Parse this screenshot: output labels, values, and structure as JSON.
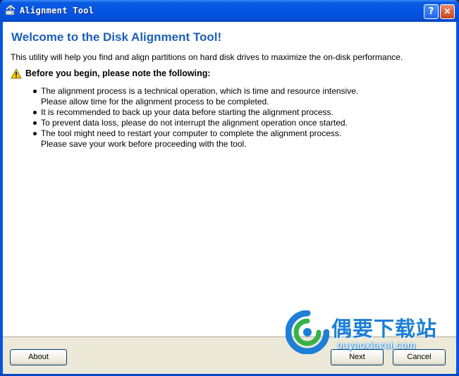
{
  "window": {
    "title": "Alignment Tool",
    "help_label": "?",
    "close_label": "×"
  },
  "content": {
    "welcome": "Welcome to the Disk Alignment Tool!",
    "intro": "This utility will help you find and align partitions on hard disk drives to maximize the on-disk performance.",
    "note_heading": "Before you begin, please note the following:",
    "bullets": [
      {
        "line1": "The alignment process is a technical operation, which is time and resource intensive.",
        "line2": "Please allow time for the alignment process to be completed."
      },
      {
        "line1": "It is recommended to back up your data before starting the alignment process.",
        "line2": ""
      },
      {
        "line1": "To prevent data loss, please do not interrupt the alignment operation once started.",
        "line2": ""
      },
      {
        "line1": "The tool might need to restart your computer to complete the alignment process.",
        "line2": "Please save your work before proceeding with the tool."
      }
    ]
  },
  "buttons": {
    "about": "About",
    "next": "Next",
    "cancel": "Cancel"
  },
  "watermark": {
    "text": "偶要下载站",
    "url": "ouyaoxiazai.com"
  },
  "colors": {
    "title_bar": "#0554e3",
    "heading": "#1c5fb8",
    "dialog_bg": "#ece9d8"
  },
  "icons": {
    "title": "disk-alignment-icon",
    "warning": "warning-icon"
  }
}
